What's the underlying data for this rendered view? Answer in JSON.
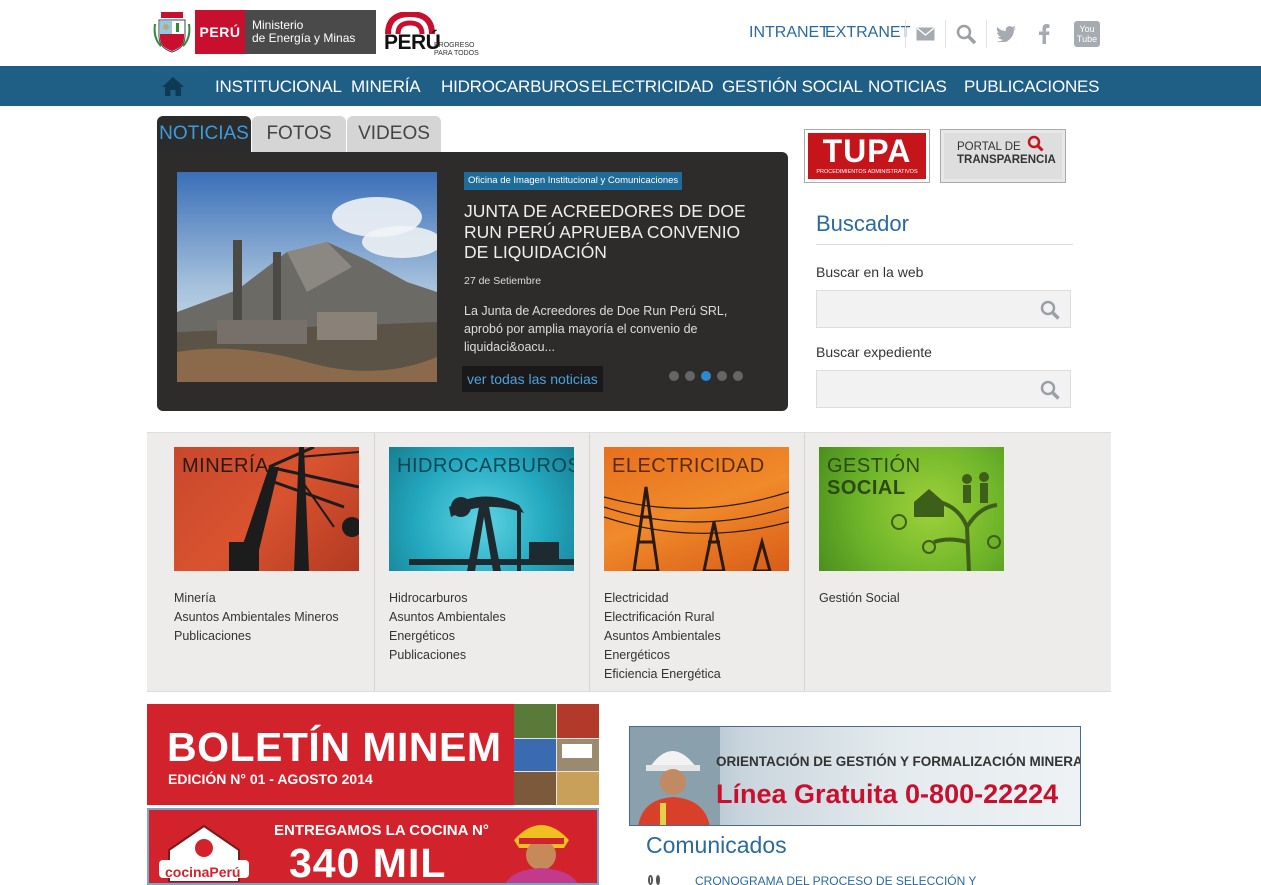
{
  "header": {
    "peru_label": "PERÚ",
    "ministry_line1": "Ministerio",
    "ministry_line2": "de Energía y Minas",
    "brand_name": "PERÚ",
    "brand_tag_line1": "PROGRESO",
    "brand_tag_line2": "PARA TODOS",
    "links": [
      "INTRANET",
      "EXTRANET"
    ],
    "youtube_line1": "You",
    "youtube_line2": "Tube"
  },
  "nav": {
    "items": [
      "INSTITUCIONAL",
      "MINERÍA",
      "HIDROCARBUROS",
      "ELECTRICIDAD",
      "GESTIÓN SOCIAL",
      "NOTICIAS",
      "PUBLICACIONES"
    ]
  },
  "news": {
    "tabs": [
      "NOTICIAS",
      "FOTOS",
      "VIDEOS"
    ],
    "active_tab": "NOTICIAS",
    "category": "Oficina de Imagen Institucional y Comunicaciones",
    "title": "JUNTA DE ACREEDORES DE DOE RUN PERÚ APRUEBA CONVENIO DE LIQUIDACIÓN",
    "date": "27 de Setiembre",
    "description": "La Junta de Acreedores de Doe Run Perú SRL, aprobó por amplia mayoría el convenio de liquidaci&oacu...",
    "more_link": "ver todas las noticias",
    "slides_total": 5,
    "slide_active": 3
  },
  "sidebar": {
    "tupa_title": "TUPA",
    "tupa_sub": "PROCEDIMIENTOS ADMINISTRATIVOS",
    "transparency_line1": "PORTAL DE",
    "transparency_line2": "TRANSPARENCIA",
    "search_title": "Buscador",
    "search_web_label": "Buscar en la web",
    "search_file_label": "Buscar expediente",
    "search_web_value": "",
    "search_file_value": ""
  },
  "categories": [
    {
      "title": "MINERÍA",
      "links": [
        "Minería",
        "Asuntos Ambientales Mineros",
        "Publicaciones"
      ]
    },
    {
      "title": "HIDROCARBUROS",
      "links": [
        "Hidrocarburos",
        "Asuntos Ambientales",
        "Energéticos",
        "Publicaciones"
      ]
    },
    {
      "title": "ELECTRICIDAD",
      "links": [
        "Electricidad",
        "Electrificación Rural",
        "Asuntos Ambientales",
        "Energéticos",
        "Eficiencia Energética"
      ]
    },
    {
      "title_line1": "GESTIÓN",
      "title_line2": "SOCIAL",
      "links": [
        "Gestión Social"
      ]
    }
  ],
  "banners": {
    "boletin_title": "BOLETÍN MINEM",
    "boletin_edition": "EDICIÓN N° 01 - AGOSTO 2014",
    "cocina_line1": "ENTREGAMOS LA COCINA N°",
    "cocina_number": "340 MIL",
    "cocina_brand": "cocinaPerú",
    "linea_line1": "ORIENTACIÓN DE GESTIÓN Y FORMALIZACIÓN MINERA",
    "linea_line2": "Línea Gratuita 0-800-22224"
  },
  "comunicados": {
    "title": "Comunicados",
    "first_item": "CRONOGRAMA DEL PROCESO DE SELECCIÓN Y"
  },
  "colors": {
    "nav_bg": "#1f5f86",
    "accent_blue": "#2a6aa0",
    "brand_red": "#c8102e",
    "news_bg": "#2e2b2b"
  }
}
